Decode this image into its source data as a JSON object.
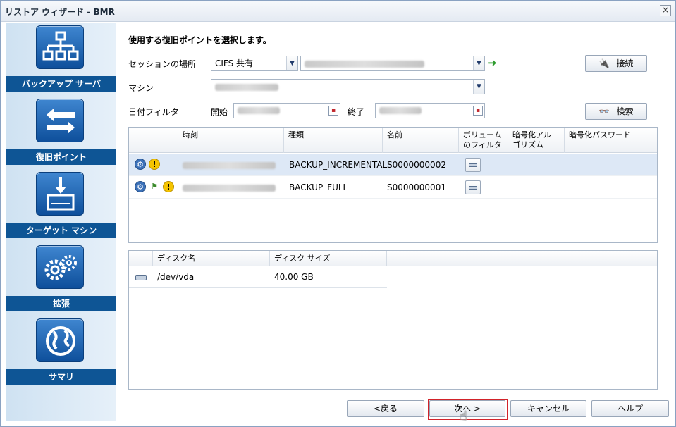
{
  "window": {
    "title": "リストア ウィザード - BMR",
    "close_glyph": "×"
  },
  "sidebar": {
    "steps": [
      {
        "label": "バックアップ サーバ",
        "icon": "backup-server-icon"
      },
      {
        "label": "復旧ポイント",
        "icon": "recovery-point-icon"
      },
      {
        "label": "ターゲット マシン",
        "icon": "target-machine-icon"
      },
      {
        "label": "拡張",
        "icon": "advanced-gear-icon"
      },
      {
        "label": "サマリ",
        "icon": "summary-globe-icon"
      }
    ]
  },
  "form": {
    "heading": "使用する復旧ポイントを選択します。",
    "session_location_label": "セッションの場所",
    "session_type_value": "CIFS 共有",
    "connect_label": "接続",
    "machine_label": "マシン",
    "date_filter_label": "日付フィルタ",
    "start_label": "開始",
    "end_label": "終了",
    "search_label": "検索"
  },
  "recovery_grid": {
    "columns": [
      "時刻",
      "種類",
      "名前",
      "ボリューム\nのフィルタ",
      "暗号化アル\nゴリズム",
      "暗号化パスワード"
    ],
    "rows": [
      {
        "type": "BACKUP_INCREMENTAL",
        "name": "S0000000002",
        "selected": true
      },
      {
        "type": "BACKUP_FULL",
        "name": "S0000000001",
        "selected": false
      }
    ]
  },
  "disk_grid": {
    "columns": [
      "ディスク名",
      "ディスク サイズ"
    ],
    "rows": [
      {
        "name": "/dev/vda",
        "size": "40.00 GB"
      }
    ]
  },
  "footer": {
    "back_label": "<戻る",
    "next_label": "次へ >",
    "cancel_label": "キャンセル",
    "help_label": "ヘルプ"
  },
  "colors": {
    "accent": "#0e5595",
    "highlight": "#d2232a",
    "selected_row": "#dde8f6"
  }
}
